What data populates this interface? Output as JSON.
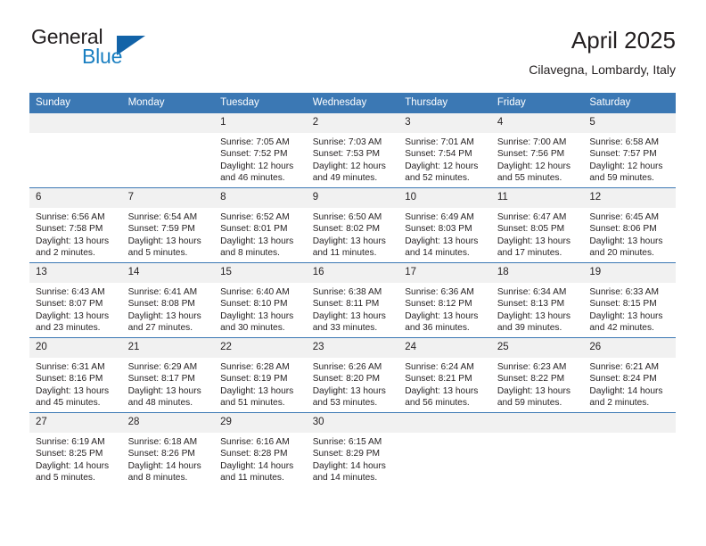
{
  "brand": {
    "word1": "General",
    "word2": "Blue",
    "triangle_color": "#1263a8",
    "blue_text_color": "#1a7fc1"
  },
  "header": {
    "title": "April 2025",
    "subtitle": "Cilavegna, Lombardy, Italy",
    "header_bg_color": "#3b78b4",
    "daynum_bg_color": "#f1f1f1"
  },
  "labels": {
    "sunrise_prefix": "Sunrise:",
    "sunset_prefix": "Sunset:",
    "daylight_prefix": "Daylight:"
  },
  "weekdays": [
    "Sunday",
    "Monday",
    "Tuesday",
    "Wednesday",
    "Thursday",
    "Friday",
    "Saturday"
  ],
  "weeks": [
    [
      {
        "day": "",
        "blank": true,
        "sunrise": "",
        "sunset": "",
        "daylight_line1": "",
        "daylight_line2": ""
      },
      {
        "day": "",
        "blank": true,
        "sunrise": "",
        "sunset": "",
        "daylight_line1": "",
        "daylight_line2": ""
      },
      {
        "day": "1",
        "sunrise": "Sunrise: 7:05 AM",
        "sunset": "Sunset: 7:52 PM",
        "daylight_line1": "Daylight: 12 hours",
        "daylight_line2": "and 46 minutes."
      },
      {
        "day": "2",
        "sunrise": "Sunrise: 7:03 AM",
        "sunset": "Sunset: 7:53 PM",
        "daylight_line1": "Daylight: 12 hours",
        "daylight_line2": "and 49 minutes."
      },
      {
        "day": "3",
        "sunrise": "Sunrise: 7:01 AM",
        "sunset": "Sunset: 7:54 PM",
        "daylight_line1": "Daylight: 12 hours",
        "daylight_line2": "and 52 minutes."
      },
      {
        "day": "4",
        "sunrise": "Sunrise: 7:00 AM",
        "sunset": "Sunset: 7:56 PM",
        "daylight_line1": "Daylight: 12 hours",
        "daylight_line2": "and 55 minutes."
      },
      {
        "day": "5",
        "sunrise": "Sunrise: 6:58 AM",
        "sunset": "Sunset: 7:57 PM",
        "daylight_line1": "Daylight: 12 hours",
        "daylight_line2": "and 59 minutes."
      }
    ],
    [
      {
        "day": "6",
        "sunrise": "Sunrise: 6:56 AM",
        "sunset": "Sunset: 7:58 PM",
        "daylight_line1": "Daylight: 13 hours",
        "daylight_line2": "and 2 minutes."
      },
      {
        "day": "7",
        "sunrise": "Sunrise: 6:54 AM",
        "sunset": "Sunset: 7:59 PM",
        "daylight_line1": "Daylight: 13 hours",
        "daylight_line2": "and 5 minutes."
      },
      {
        "day": "8",
        "sunrise": "Sunrise: 6:52 AM",
        "sunset": "Sunset: 8:01 PM",
        "daylight_line1": "Daylight: 13 hours",
        "daylight_line2": "and 8 minutes."
      },
      {
        "day": "9",
        "sunrise": "Sunrise: 6:50 AM",
        "sunset": "Sunset: 8:02 PM",
        "daylight_line1": "Daylight: 13 hours",
        "daylight_line2": "and 11 minutes."
      },
      {
        "day": "10",
        "sunrise": "Sunrise: 6:49 AM",
        "sunset": "Sunset: 8:03 PM",
        "daylight_line1": "Daylight: 13 hours",
        "daylight_line2": "and 14 minutes."
      },
      {
        "day": "11",
        "sunrise": "Sunrise: 6:47 AM",
        "sunset": "Sunset: 8:05 PM",
        "daylight_line1": "Daylight: 13 hours",
        "daylight_line2": "and 17 minutes."
      },
      {
        "day": "12",
        "sunrise": "Sunrise: 6:45 AM",
        "sunset": "Sunset: 8:06 PM",
        "daylight_line1": "Daylight: 13 hours",
        "daylight_line2": "and 20 minutes."
      }
    ],
    [
      {
        "day": "13",
        "sunrise": "Sunrise: 6:43 AM",
        "sunset": "Sunset: 8:07 PM",
        "daylight_line1": "Daylight: 13 hours",
        "daylight_line2": "and 23 minutes."
      },
      {
        "day": "14",
        "sunrise": "Sunrise: 6:41 AM",
        "sunset": "Sunset: 8:08 PM",
        "daylight_line1": "Daylight: 13 hours",
        "daylight_line2": "and 27 minutes."
      },
      {
        "day": "15",
        "sunrise": "Sunrise: 6:40 AM",
        "sunset": "Sunset: 8:10 PM",
        "daylight_line1": "Daylight: 13 hours",
        "daylight_line2": "and 30 minutes."
      },
      {
        "day": "16",
        "sunrise": "Sunrise: 6:38 AM",
        "sunset": "Sunset: 8:11 PM",
        "daylight_line1": "Daylight: 13 hours",
        "daylight_line2": "and 33 minutes."
      },
      {
        "day": "17",
        "sunrise": "Sunrise: 6:36 AM",
        "sunset": "Sunset: 8:12 PM",
        "daylight_line1": "Daylight: 13 hours",
        "daylight_line2": "and 36 minutes."
      },
      {
        "day": "18",
        "sunrise": "Sunrise: 6:34 AM",
        "sunset": "Sunset: 8:13 PM",
        "daylight_line1": "Daylight: 13 hours",
        "daylight_line2": "and 39 minutes."
      },
      {
        "day": "19",
        "sunrise": "Sunrise: 6:33 AM",
        "sunset": "Sunset: 8:15 PM",
        "daylight_line1": "Daylight: 13 hours",
        "daylight_line2": "and 42 minutes."
      }
    ],
    [
      {
        "day": "20",
        "sunrise": "Sunrise: 6:31 AM",
        "sunset": "Sunset: 8:16 PM",
        "daylight_line1": "Daylight: 13 hours",
        "daylight_line2": "and 45 minutes."
      },
      {
        "day": "21",
        "sunrise": "Sunrise: 6:29 AM",
        "sunset": "Sunset: 8:17 PM",
        "daylight_line1": "Daylight: 13 hours",
        "daylight_line2": "and 48 minutes."
      },
      {
        "day": "22",
        "sunrise": "Sunrise: 6:28 AM",
        "sunset": "Sunset: 8:19 PM",
        "daylight_line1": "Daylight: 13 hours",
        "daylight_line2": "and 51 minutes."
      },
      {
        "day": "23",
        "sunrise": "Sunrise: 6:26 AM",
        "sunset": "Sunset: 8:20 PM",
        "daylight_line1": "Daylight: 13 hours",
        "daylight_line2": "and 53 minutes."
      },
      {
        "day": "24",
        "sunrise": "Sunrise: 6:24 AM",
        "sunset": "Sunset: 8:21 PM",
        "daylight_line1": "Daylight: 13 hours",
        "daylight_line2": "and 56 minutes."
      },
      {
        "day": "25",
        "sunrise": "Sunrise: 6:23 AM",
        "sunset": "Sunset: 8:22 PM",
        "daylight_line1": "Daylight: 13 hours",
        "daylight_line2": "and 59 minutes."
      },
      {
        "day": "26",
        "sunrise": "Sunrise: 6:21 AM",
        "sunset": "Sunset: 8:24 PM",
        "daylight_line1": "Daylight: 14 hours",
        "daylight_line2": "and 2 minutes."
      }
    ],
    [
      {
        "day": "27",
        "sunrise": "Sunrise: 6:19 AM",
        "sunset": "Sunset: 8:25 PM",
        "daylight_line1": "Daylight: 14 hours",
        "daylight_line2": "and 5 minutes."
      },
      {
        "day": "28",
        "sunrise": "Sunrise: 6:18 AM",
        "sunset": "Sunset: 8:26 PM",
        "daylight_line1": "Daylight: 14 hours",
        "daylight_line2": "and 8 minutes."
      },
      {
        "day": "29",
        "sunrise": "Sunrise: 6:16 AM",
        "sunset": "Sunset: 8:28 PM",
        "daylight_line1": "Daylight: 14 hours",
        "daylight_line2": "and 11 minutes."
      },
      {
        "day": "30",
        "sunrise": "Sunrise: 6:15 AM",
        "sunset": "Sunset: 8:29 PM",
        "daylight_line1": "Daylight: 14 hours",
        "daylight_line2": "and 14 minutes."
      },
      {
        "day": "",
        "blank": true,
        "sunrise": "",
        "sunset": "",
        "daylight_line1": "",
        "daylight_line2": ""
      },
      {
        "day": "",
        "blank": true,
        "sunrise": "",
        "sunset": "",
        "daylight_line1": "",
        "daylight_line2": ""
      },
      {
        "day": "",
        "blank": true,
        "sunrise": "",
        "sunset": "",
        "daylight_line1": "",
        "daylight_line2": ""
      }
    ]
  ]
}
